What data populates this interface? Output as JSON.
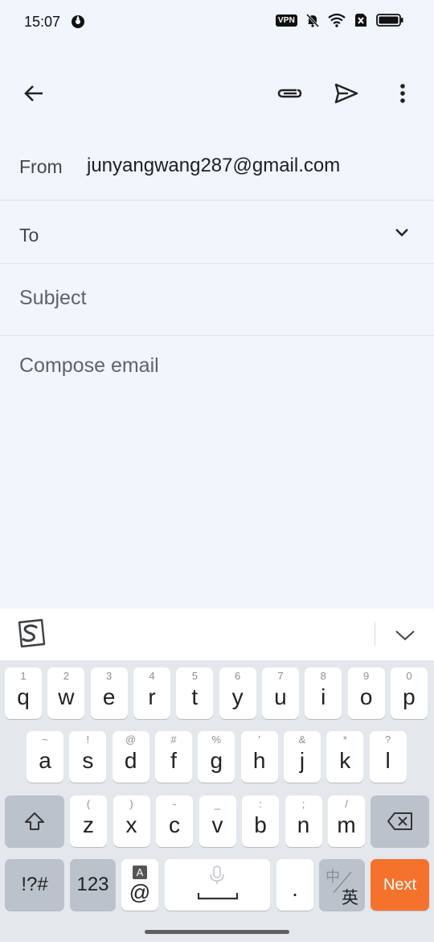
{
  "status_bar": {
    "time": "15:07",
    "vpn_label": "VPN",
    "icons": [
      "app-icon",
      "vpn-icon",
      "bell-muted-icon",
      "wifi-icon",
      "sim-off-icon",
      "battery-icon"
    ]
  },
  "app_bar": {
    "icons": [
      "back-arrow-icon",
      "attach-icon",
      "send-icon",
      "more-vert-icon"
    ]
  },
  "compose": {
    "from_label": "From",
    "from_value": "junyangwang287@gmail.com",
    "to_label": "To",
    "subject_placeholder": "Subject",
    "body_placeholder": "Compose email"
  },
  "keyboard": {
    "row1": [
      {
        "main": "q",
        "sub": "1"
      },
      {
        "main": "w",
        "sub": "2"
      },
      {
        "main": "e",
        "sub": "3"
      },
      {
        "main": "r",
        "sub": "4"
      },
      {
        "main": "t",
        "sub": "5"
      },
      {
        "main": "y",
        "sub": "6"
      },
      {
        "main": "u",
        "sub": "7"
      },
      {
        "main": "i",
        "sub": "8"
      },
      {
        "main": "o",
        "sub": "9"
      },
      {
        "main": "p",
        "sub": "0"
      }
    ],
    "row2": [
      {
        "main": "a",
        "sub": "~"
      },
      {
        "main": "s",
        "sub": "!"
      },
      {
        "main": "d",
        "sub": "@"
      },
      {
        "main": "f",
        "sub": "#"
      },
      {
        "main": "g",
        "sub": "%"
      },
      {
        "main": "h",
        "sub": "'"
      },
      {
        "main": "j",
        "sub": "&"
      },
      {
        "main": "k",
        "sub": "*"
      },
      {
        "main": "l",
        "sub": "?"
      }
    ],
    "row3": [
      {
        "main": "z",
        "sub": "("
      },
      {
        "main": "x",
        "sub": ")"
      },
      {
        "main": "c",
        "sub": "-"
      },
      {
        "main": "v",
        "sub": "_"
      },
      {
        "main": "b",
        "sub": ":"
      },
      {
        "main": "n",
        "sub": ";"
      },
      {
        "main": "m",
        "sub": "/"
      }
    ],
    "symbols_label": "!?#",
    "numbers_label": "123",
    "at_top_label": "A",
    "at_label": "@",
    "period_label": ".",
    "lang_top": "中",
    "lang_bottom": "英",
    "next_label": "Next"
  },
  "colors": {
    "background": "#f1f6fc",
    "next_key": "#f5722d",
    "keyboard_bg": "#e4e7ec"
  }
}
